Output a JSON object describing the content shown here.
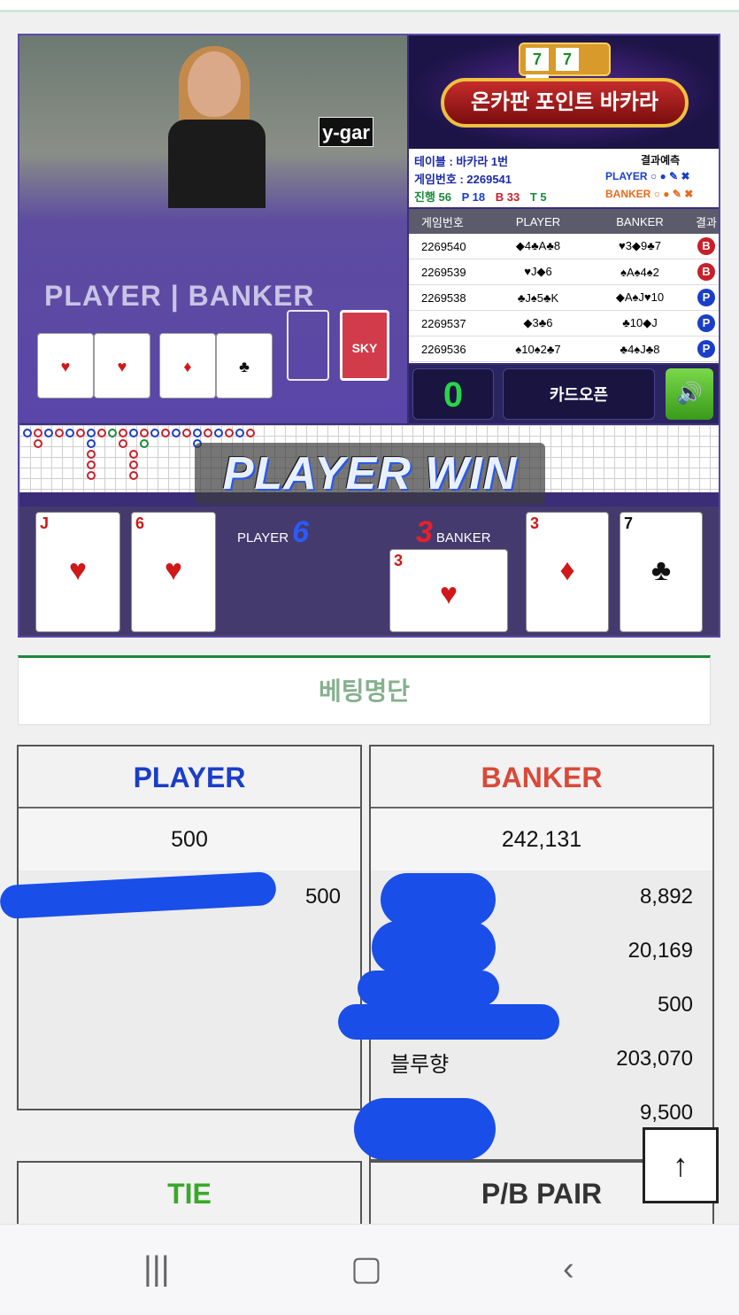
{
  "game": {
    "overlay_label": "y-gar",
    "table_label": "PLAYER | BANKER",
    "banner": {
      "title": "온카판 포인트 바카라",
      "slot": [
        "7",
        "7",
        "7"
      ]
    },
    "info": {
      "table": "테이블 : 바카라 1번",
      "game_no": "게임번호 : 2269541",
      "progress": "진행 56",
      "p_count": "P 18",
      "b_count": "B 33",
      "t_count": "T 5",
      "predict_label": "결과예측",
      "predict_player": "PLAYER",
      "predict_banker": "BANKER"
    },
    "history": {
      "headers": [
        "게임번호",
        "PLAYER",
        "BANKER",
        "결과"
      ],
      "rows": [
        {
          "no": "2269540",
          "player": "◆4♣A♣8",
          "banker": "♥3◆9♣7",
          "result": "B"
        },
        {
          "no": "2269539",
          "player": "♥J◆6",
          "banker": "♠A♠4♠2",
          "result": "B"
        },
        {
          "no": "2269538",
          "player": "♣J♠5♣K",
          "banker": "◆A♠J♥10",
          "result": "P"
        },
        {
          "no": "2269537",
          "player": "◆3♣6",
          "banker": "♣10◆J",
          "result": "P"
        },
        {
          "no": "2269536",
          "player": "♠10♠2♣7",
          "banker": "♣4♠J♣8",
          "result": "P"
        }
      ]
    },
    "controls": {
      "countdown": "0",
      "open_label": "카드오픈",
      "sound_icon": "speaker-icon"
    },
    "win_text": "PLAYER WIN",
    "result": {
      "player_label": "PLAYER",
      "player_score": "6",
      "banker_label": "BANKER",
      "banker_score": "3",
      "player_cards": [
        {
          "rank": "J",
          "suit": "♥"
        },
        {
          "rank": "6",
          "suit": "♥"
        }
      ],
      "banker_cards": [
        {
          "rank": "3",
          "suit": "♥"
        },
        {
          "rank": "3",
          "suit": "♦"
        },
        {
          "rank": "7",
          "suit": "♣"
        }
      ]
    }
  },
  "betting": {
    "tab_label": "베팅명단",
    "player": {
      "title": "PLAYER",
      "total": "500",
      "entries": [
        {
          "name": "",
          "amount": "500"
        }
      ]
    },
    "banker": {
      "title": "BANKER",
      "total": "242,131",
      "entries": [
        {
          "name": "",
          "amount": "8,892"
        },
        {
          "name": "",
          "amount": "20,169"
        },
        {
          "name": "",
          "amount": "500"
        },
        {
          "name": "블루향",
          "amount": "203,070"
        },
        {
          "name": "",
          "amount": "9,500"
        }
      ]
    },
    "tie": {
      "title": "TIE"
    },
    "pair": {
      "title": "P/B PAIR"
    }
  },
  "ui": {
    "to_top_icon": "↑"
  },
  "colors": {
    "accent_green": "#1a8a3a",
    "player_blue": "#1a3ec8",
    "banker_red": "#d84a3a",
    "tie_green": "#3aa82a"
  }
}
